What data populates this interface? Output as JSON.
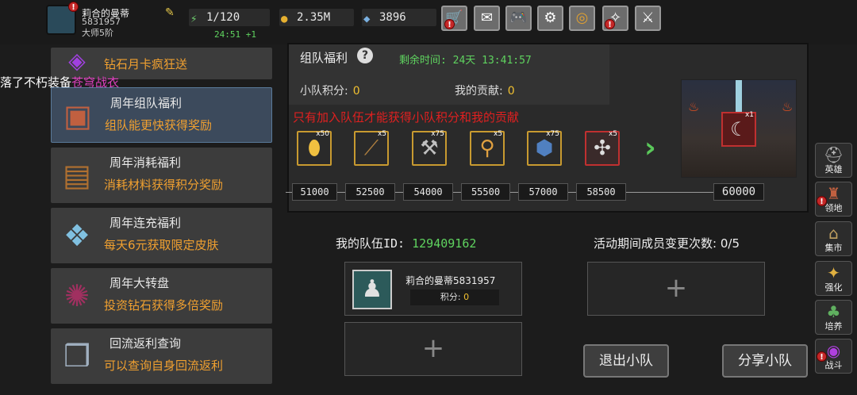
{
  "player": {
    "name": "莉合的曼蒂",
    "id": "5831957",
    "rank": "大师5阶",
    "alert": "!"
  },
  "stats": {
    "energy": "1/120",
    "timer": "24:51 +1",
    "gold": "2.35M",
    "gems": "3896"
  },
  "top_buttons": [
    "shop",
    "mail",
    "gamepad",
    "settings",
    "color-wheel",
    "broom",
    "tools"
  ],
  "notice": {
    "prefix": "落了不朽装备",
    "item": "苍穹战衣"
  },
  "list": [
    {
      "title": "",
      "subtitle": "钻石月卡疯狂送",
      "icon": "purple-card-icon"
    },
    {
      "title": "周年组队福利",
      "subtitle": "组队能更快获得奖励",
      "icon": "chest-icon"
    },
    {
      "title": "周年消耗福利",
      "subtitle": "消耗材料获得积分奖励",
      "icon": "open-chest-icon"
    },
    {
      "title": "周年连充福利",
      "subtitle": "每天6元获取限定皮肤",
      "icon": "crystal-icon"
    },
    {
      "title": "周年大转盘",
      "subtitle": "投资钻石获得多倍奖励",
      "icon": "wheel-icon"
    },
    {
      "title": "回流返利查询",
      "subtitle": "可以查询自身回流返利",
      "icon": "box-icon"
    }
  ],
  "panel": {
    "title": "组队福利",
    "remaining_label": "剩余时间:",
    "remaining_value": "24天 13:41:57",
    "score_label": "小队积分:",
    "score_value": "0",
    "contrib_label": "我的贡献:",
    "contrib_value": "0",
    "warning": "只有加入队伍才能获得小队积分和我的贡献",
    "rewards": [
      {
        "qty": "x50",
        "icon": "egg-icon"
      },
      {
        "qty": "x5",
        "icon": "scroll-icon"
      },
      {
        "qty": "x75",
        "icon": "mace-icon"
      },
      {
        "qty": "x5",
        "icon": "staff-icon"
      },
      {
        "qty": "x75",
        "icon": "ore-icon"
      },
      {
        "qty": "x5",
        "icon": "bones-icon"
      }
    ],
    "milestones": [
      "51000",
      "52500",
      "54000",
      "55500",
      "57000",
      "58500",
      "60000"
    ],
    "big_reward_qty": "x1"
  },
  "team": {
    "id_label": "我的队伍ID:",
    "id_value": "129409162",
    "changes_label": "活动期间成员变更次数:",
    "changes_value": "0/5",
    "member_name": "莉合的曼蒂5831957",
    "member_score_label": "积分:",
    "member_score_value": "0",
    "add_symbol": "+",
    "leave_btn": "退出小队",
    "share_btn": "分享小队"
  },
  "sidebar": [
    {
      "label": "英雄",
      "icon": "helmet-icon",
      "alert": false
    },
    {
      "label": "领地",
      "icon": "castle-icon",
      "alert": true
    },
    {
      "label": "集市",
      "icon": "market-icon",
      "alert": false
    },
    {
      "label": "强化",
      "icon": "enhance-icon",
      "alert": false
    },
    {
      "label": "培养",
      "icon": "tree-icon",
      "alert": false
    },
    {
      "label": "战斗",
      "icon": "portal-icon",
      "alert": true
    }
  ]
}
